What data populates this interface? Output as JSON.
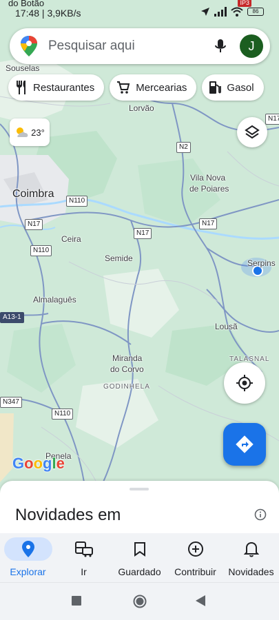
{
  "status": {
    "top_text": "do Botão",
    "time_speed": "17:48 | 3,9KB/s",
    "battery": "86",
    "badge": "IP3"
  },
  "search": {
    "placeholder": "Pesquisar aqui",
    "avatar_letter": "J"
  },
  "chips": [
    {
      "label": "Restaurantes",
      "icon": "restaurant-icon"
    },
    {
      "label": "Mercearias",
      "icon": "cart-icon"
    },
    {
      "label": "Gasol",
      "icon": "gas-station-icon"
    }
  ],
  "weather": {
    "temp": "23°",
    "icon": "partly-sunny-icon"
  },
  "map": {
    "labels": {
      "souselas": "Souselas",
      "lorvao": "Lorvão",
      "coimbra": "Coimbra",
      "vila_nova": "Vila Nova",
      "de_poiares": "de Poiares",
      "ceira": "Ceira",
      "semide": "Semide",
      "serpins": "Serpins",
      "almalaguês": "Almalaguês",
      "lousa": "Lousã",
      "miranda": "Miranda",
      "do_corvo": "do Corvo",
      "godinhela": "GODINHELA",
      "talasnal": "TALASNAL",
      "penela": "Penela"
    },
    "shields": {
      "n2": "N2",
      "n110_a": "N110",
      "n17_a": "N17",
      "n17_b": "N17",
      "n17_c": "N17",
      "n110_b": "N110",
      "a13": "A13-1",
      "n347": "N347",
      "n110_c": "N110",
      "n17_top": "N17"
    },
    "brand": [
      "G",
      "o",
      "o",
      "g",
      "l",
      "e"
    ]
  },
  "sheet": {
    "title": "Novidades em"
  },
  "nav": [
    {
      "label": "Explorar",
      "icon": "explore-pin-icon",
      "active": true
    },
    {
      "label": "Ir",
      "icon": "commute-icon",
      "active": false
    },
    {
      "label": "Guardado",
      "icon": "bookmark-icon",
      "active": false
    },
    {
      "label": "Contribuir",
      "icon": "add-circle-icon",
      "active": false
    },
    {
      "label": "Novidades",
      "icon": "bell-icon",
      "active": false
    }
  ],
  "colors": {
    "accent": "#1a73e8",
    "map_green": "#d7ecdf",
    "road_blue": "#6e86b8",
    "avatar_bg": "#1b5e20"
  }
}
